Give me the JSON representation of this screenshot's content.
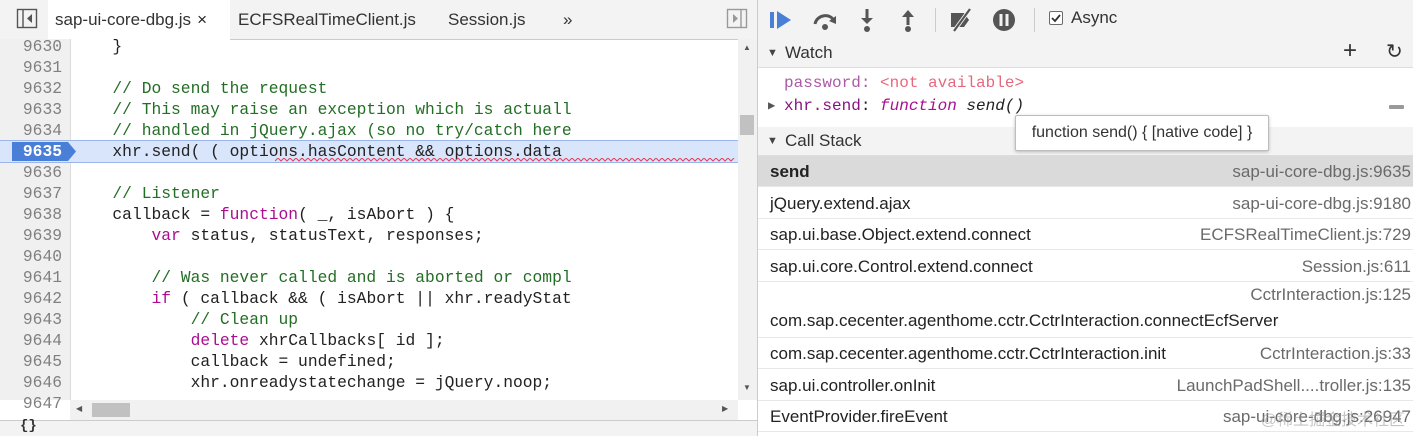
{
  "tabs": [
    {
      "label": "sap-ui-core-dbg.js",
      "active": true,
      "close": "×"
    },
    {
      "label": "ECFSRealTimeClient.js",
      "active": false
    },
    {
      "label": "Session.js",
      "active": false
    }
  ],
  "tabs_overflow": "»",
  "code_lines": [
    {
      "num": "9630",
      "segments": [
        {
          "t": "                    }",
          "c": ""
        }
      ]
    },
    {
      "num": "9631",
      "segments": []
    },
    {
      "num": "9632",
      "segments": [
        {
          "t": "                    // Do send the request",
          "c": "cm"
        }
      ]
    },
    {
      "num": "9633",
      "segments": [
        {
          "t": "                    // This may raise an exception which is actuall",
          "c": "cm"
        }
      ]
    },
    {
      "num": "9634",
      "segments": [
        {
          "t": "                    // handled in jQuery.ajax (so no try/catch here",
          "c": "cm"
        }
      ]
    },
    {
      "num": "9635",
      "exec": true,
      "segments": [
        {
          "t": "                    xhr.send( ( options.hasContent && options.data",
          "c": ""
        }
      ]
    },
    {
      "num": "9636",
      "segments": []
    },
    {
      "num": "9637",
      "segments": [
        {
          "t": "                    // Listener",
          "c": "cm"
        }
      ]
    },
    {
      "num": "9638",
      "segments": [
        {
          "t": "                    callback = ",
          "c": ""
        },
        {
          "t": "function",
          "c": "kw"
        },
        {
          "t": "( _, isAbort ) {",
          "c": ""
        }
      ]
    },
    {
      "num": "9639",
      "segments": [
        {
          "t": "                        ",
          "c": ""
        },
        {
          "t": "var",
          "c": "kw"
        },
        {
          "t": " status, statusText, responses;",
          "c": ""
        }
      ]
    },
    {
      "num": "9640",
      "segments": []
    },
    {
      "num": "9641",
      "segments": [
        {
          "t": "                        // Was never called and is aborted or compl",
          "c": "cm"
        }
      ]
    },
    {
      "num": "9642",
      "segments": [
        {
          "t": "                        ",
          "c": ""
        },
        {
          "t": "if",
          "c": "kw"
        },
        {
          "t": " ( callback && ( isAbort || xhr.readyStat",
          "c": ""
        }
      ]
    },
    {
      "num": "9643",
      "segments": [
        {
          "t": "                            // Clean up",
          "c": "cm"
        }
      ]
    },
    {
      "num": "9644",
      "segments": [
        {
          "t": "                            ",
          "c": ""
        },
        {
          "t": "delete",
          "c": "kw"
        },
        {
          "t": " xhrCallbacks[ id ];",
          "c": ""
        }
      ]
    },
    {
      "num": "9645",
      "segments": [
        {
          "t": "                            callback = undefined;",
          "c": ""
        }
      ]
    },
    {
      "num": "9646",
      "segments": [
        {
          "t": "                            xhr.onreadystatechange = jQuery.noop;",
          "c": ""
        }
      ]
    },
    {
      "num": "9647",
      "segments": []
    }
  ],
  "statusbar_text": "{}",
  "toolbar": {
    "async_label": "Async",
    "async_checked": true
  },
  "watch": {
    "title": "Watch",
    "add_label": "+",
    "refresh_label": "↻",
    "items": [
      {
        "name": "password",
        "sep": ": ",
        "value": "<not available>",
        "kind": "na",
        "expandable": false
      },
      {
        "name": "xhr.send",
        "sep": ": ",
        "value_kw": "function",
        "value": " send()",
        "kind": "fn",
        "expandable": true
      }
    ]
  },
  "tooltip": "function send() { [native code] }",
  "callstack": {
    "title": "Call Stack",
    "frames": [
      {
        "fn": "send",
        "loc": "sap-ui-core-dbg.js:9635",
        "selected": true
      },
      {
        "fn": "jQuery.extend.ajax",
        "loc": "sap-ui-core-dbg.js:9180"
      },
      {
        "fn": "sap.ui.base.Object.extend.connect",
        "loc": "ECFSRealTimeClient.js:729"
      },
      {
        "fn": "sap.ui.core.Control.extend.connect",
        "loc": "Session.js:611"
      },
      {
        "fn": "com.sap.cecenter.agenthome.cctr.CctrInteraction.connectEcfServer",
        "loc": "CctrInteraction.js:125",
        "tall": true
      },
      {
        "fn": "com.sap.cecenter.agenthome.cctr.CctrInteraction.init",
        "loc": "CctrInteraction.js:33"
      },
      {
        "fn": "sap.ui.controller.onInit",
        "loc": "LaunchPadShell....troller.js:135"
      },
      {
        "fn": "EventProvider.fireEvent",
        "loc": "sap-ui-core-dbg.js:26947"
      }
    ]
  },
  "watermark": "@稀土掘金技术社区",
  "colors": {
    "accent": "#4a7fd8",
    "exec_line": "#d8e5fb",
    "comment": "#236e25",
    "keyword": "#aa0d91"
  }
}
